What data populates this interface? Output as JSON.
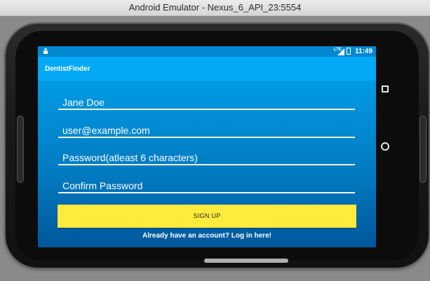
{
  "window": {
    "title": "Android Emulator - Nexus_6_API_23:5554"
  },
  "status_bar": {
    "network": "LTE",
    "time": "11:49"
  },
  "app_bar": {
    "title": "DentistFinder"
  },
  "form": {
    "name_value": "Jane Doe",
    "email_value": "user@example.com",
    "password_placeholder": "Password(atleast 6 characters)",
    "confirm_placeholder": "Confirm Password",
    "signup_label": "SIGN UP",
    "login_link": "Already have an account? Log in here!"
  },
  "colors": {
    "status_bar": "#0288d1",
    "app_bar": "#03a9f4",
    "signup_button": "#ffeb3b",
    "background_top": "#039be5",
    "background_bottom": "#01579b"
  },
  "icons": {
    "status_left": "android-icon",
    "signal": "signal-icon",
    "battery": "battery-icon",
    "nav_recents": "square-icon",
    "nav_home": "circle-icon",
    "nav_back": "triangle-back-icon"
  }
}
